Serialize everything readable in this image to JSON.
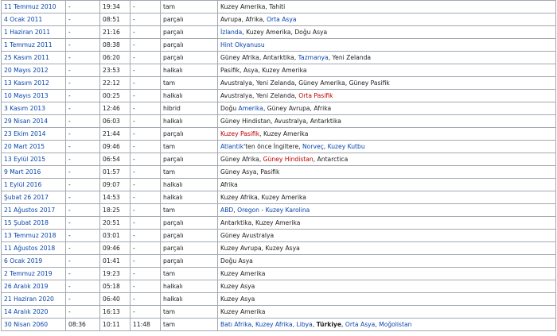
{
  "rows": [
    {
      "date": "11 Temmuz 2010",
      "c2": "-",
      "time": "19:34",
      "c4": "-",
      "type": "tam",
      "regions": [
        {
          "text": "Kuzey Amerika, Tahiti"
        }
      ]
    },
    {
      "date": "4 Ocak 2011",
      "c2": "-",
      "time": "08:51",
      "c4": "-",
      "type": "parçalı",
      "regions": [
        {
          "text": "Avrupa, Afrika, "
        },
        {
          "text": "Orta Asya",
          "link": true
        }
      ]
    },
    {
      "date": "1 Haziran 2011",
      "c2": "-",
      "time": "21:16",
      "c4": "-",
      "type": "parçalı",
      "regions": [
        {
          "text": "İzlanda",
          "link": true
        },
        {
          "text": ", Kuzey Amerika, Doğu Asya"
        }
      ]
    },
    {
      "date": "1 Temmuz 2011",
      "c2": "-",
      "time": "08:38",
      "c4": "-",
      "type": "parçalı",
      "regions": [
        {
          "text": "Hint Okyanusu",
          "link": true
        }
      ]
    },
    {
      "date": "25 Kasım 2011",
      "c2": "-",
      "time": "06:20",
      "c4": "-",
      "type": "parçalı",
      "regions": [
        {
          "text": "Güney Afrika, Antarktika, "
        },
        {
          "text": "Tazmanya",
          "link": true
        },
        {
          "text": ", Yeni Zelanda"
        }
      ]
    },
    {
      "date": "20 Mayıs 2012",
      "c2": "-",
      "time": "23:53",
      "c4": "-",
      "type": "halkalı",
      "regions": [
        {
          "text": "Pasifik, Asya, Kuzey Amerika"
        }
      ]
    },
    {
      "date": "13 Kasım 2012",
      "c2": "-",
      "time": "22:12",
      "c4": "-",
      "type": "tam",
      "regions": [
        {
          "text": "Avustralya, Yeni Zelanda, Güney Amerika, Güney Pasifik"
        }
      ]
    },
    {
      "date": "10 Mayıs 2013",
      "c2": "-",
      "time": "00:25",
      "c4": "-",
      "type": "halkalı",
      "regions": [
        {
          "text": "Avustralya, Yeni Zelanda, "
        },
        {
          "text": "Orta Pasifik",
          "red": true
        }
      ]
    },
    {
      "date": "3 Kasım 2013",
      "c2": "-",
      "time": "12:46",
      "c4": "-",
      "type": "hibrid",
      "regions": [
        {
          "text": "Doğu "
        },
        {
          "text": "Amerika",
          "link": true
        },
        {
          "text": ", Güney Avrupa, Afrika"
        }
      ]
    },
    {
      "date": "29 Nisan 2014",
      "c2": "-",
      "time": "06:03",
      "c4": "-",
      "type": "halkalı",
      "regions": [
        {
          "text": "Güney Hindistan, Avustralya, Antarktika"
        }
      ]
    },
    {
      "date": "23 Ekim 2014",
      "c2": "-",
      "time": "21:44",
      "c4": "-",
      "type": "parçalı",
      "regions": [
        {
          "text": "Kuzey Pasifik",
          "red": true
        },
        {
          "text": ", Kuzey Amerika"
        }
      ]
    },
    {
      "date": "20 Mart 2015",
      "c2": "-",
      "time": "09:46",
      "c4": "-",
      "type": "tam",
      "regions": [
        {
          "text": "Atlantik",
          "link": true
        },
        {
          "text": "'ten önce İngiltere, "
        },
        {
          "text": "Norveç",
          "link": true
        },
        {
          "text": ", "
        },
        {
          "text": "Kuzey Kutbu",
          "link": true
        }
      ]
    },
    {
      "date": "13 Eylül 2015",
      "c2": "-",
      "time": "06:54",
      "c4": "-",
      "type": "parçalı",
      "regions": [
        {
          "text": "Güney Afrika, "
        },
        {
          "text": "Güney Hindistan",
          "red": true
        },
        {
          "text": ", Antarctica"
        }
      ]
    },
    {
      "date": "9 Mart 2016",
      "c2": "-",
      "time": "01:57",
      "c4": "-",
      "type": "tam",
      "regions": [
        {
          "text": "Güney Asya, Pasifik"
        }
      ]
    },
    {
      "date": "1 Eylül 2016",
      "c2": "-",
      "time": "09:07",
      "c4": "-",
      "type": "halkalı",
      "regions": [
        {
          "text": "Afrika"
        }
      ]
    },
    {
      "date": "Şubat 26 2017",
      "c2": "-",
      "time": "14:53",
      "c4": "-",
      "type": "halkalı",
      "regions": [
        {
          "text": "Kuzey Afrika, Kuzey Amerika"
        }
      ]
    },
    {
      "date": "21 Ağustos 2017",
      "c2": "-",
      "time": "18:25",
      "c4": "-",
      "type": "tam",
      "regions": [
        {
          "text": "ABD",
          "link": true
        },
        {
          "text": ", "
        },
        {
          "text": "Oregon",
          "link": true
        },
        {
          "text": " - "
        },
        {
          "text": "Kuzey Karolina",
          "link": true
        }
      ]
    },
    {
      "date": "15 Şubat 2018",
      "c2": "-",
      "time": "20:51",
      "c4": "-",
      "type": "parçalı",
      "regions": [
        {
          "text": "Antarktika, Kuzey Amerika"
        }
      ]
    },
    {
      "date": "13 Temmuz 2018",
      "c2": "-",
      "time": "03:01",
      "c4": "-",
      "type": "parçalı",
      "regions": [
        {
          "text": "Güney Avustralya"
        }
      ]
    },
    {
      "date": "11 Ağustos 2018",
      "c2": "-",
      "time": "09:46",
      "c4": "-",
      "type": "parçalı",
      "regions": [
        {
          "text": "Kuzey Avrupa, Kuzey Asya"
        }
      ]
    },
    {
      "date": "6 Ocak 2019",
      "c2": "-",
      "time": "01:41",
      "c4": "-",
      "type": "parçalı",
      "regions": [
        {
          "text": "Doğu Asya"
        }
      ]
    },
    {
      "date": "2 Temmuz 2019",
      "c2": "-",
      "time": "19:23",
      "c4": "-",
      "type": "tam",
      "regions": [
        {
          "text": "Kuzey Amerika"
        }
      ]
    },
    {
      "date": "26 Aralık 2019",
      "c2": "-",
      "time": "05:18",
      "c4": "-",
      "type": "halkalı",
      "regions": [
        {
          "text": "Kuzey Asya"
        }
      ]
    },
    {
      "date": "21 Haziran 2020",
      "c2": "-",
      "time": "06:40",
      "c4": "-",
      "type": "halkalı",
      "regions": [
        {
          "text": "Kuzey Asya"
        }
      ]
    },
    {
      "date": "14 Aralık 2020",
      "c2": "-",
      "time": "16:13",
      "c4": "-",
      "type": "tam",
      "regions": [
        {
          "text": "Kuzey Amerika"
        }
      ]
    },
    {
      "date": "30 Nisan 2060",
      "c2": "08:36",
      "time": "10:11",
      "c4": "11:48",
      "type": "tam",
      "regions": [
        {
          "text": "Batı Afrika",
          "link": true
        },
        {
          "text": ", "
        },
        {
          "text": "Kuzey Afrika",
          "link": true
        },
        {
          "text": ", "
        },
        {
          "text": "Libya",
          "link": true
        },
        {
          "text": ", "
        },
        {
          "text": "Türkiye",
          "bold": true
        },
        {
          "text": ", "
        },
        {
          "text": "Orta Asya",
          "link": true
        },
        {
          "text": ", "
        },
        {
          "text": "Moğolistan",
          "link": true
        }
      ]
    }
  ]
}
